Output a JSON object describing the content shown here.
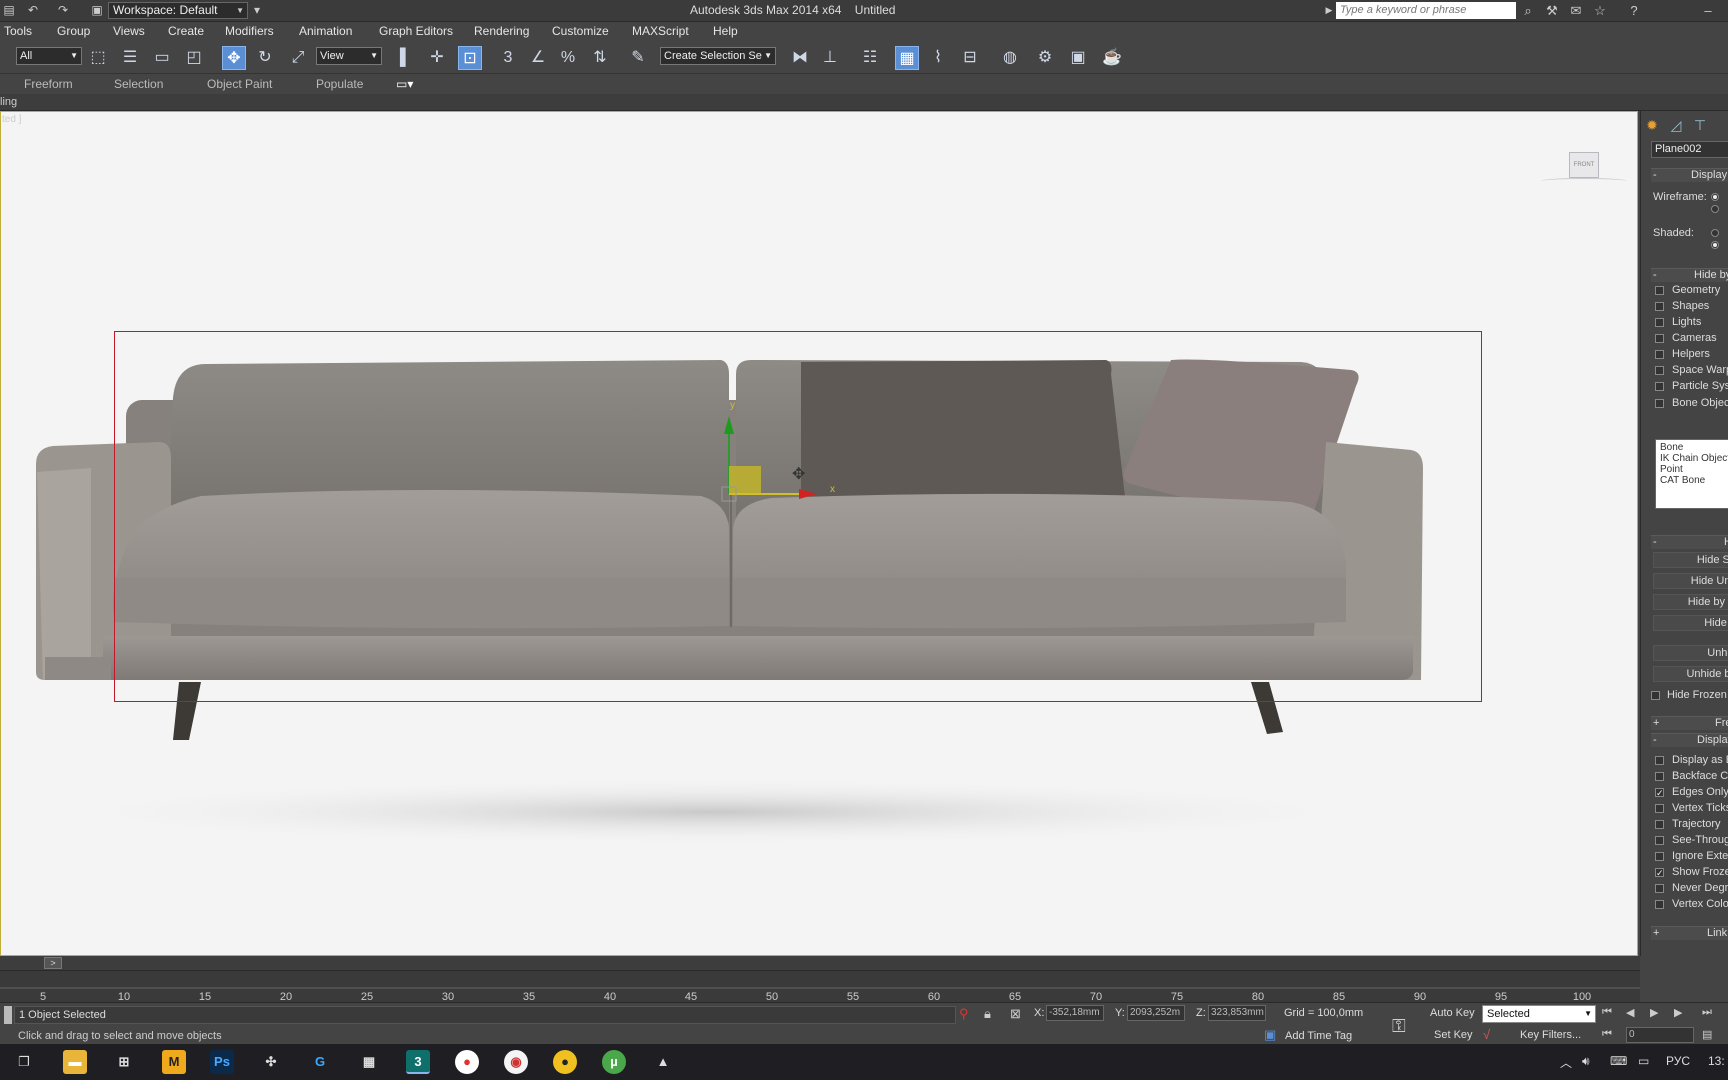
{
  "titlebar": {
    "workspace_label": "Workspace: Default",
    "app_title": "Autodesk 3ds Max  2014 x64",
    "doc_title": "Untitled",
    "search_placeholder": "Type a keyword or phrase"
  },
  "menu": {
    "items": [
      "Tools",
      "Group",
      "Views",
      "Create",
      "Modifiers",
      "Animation",
      "Graph Editors",
      "Rendering",
      "Customize",
      "MAXScript",
      "Help"
    ]
  },
  "toolbar": {
    "filter_value": "All",
    "refcoord_value": "View",
    "selection_set_value": "Create Selection Se",
    "snap_label": "3",
    "percent_label": "%"
  },
  "ribbon": {
    "tabs": [
      "Freeform",
      "Selection",
      "Object Paint",
      "Populate"
    ],
    "sub_label": "ling"
  },
  "viewport": {
    "label": "ted ]",
    "viewcube_label": "FRONT",
    "gizmo_y": "y",
    "gizmo_x": "x"
  },
  "command_panel": {
    "object_name": "Plane002",
    "rollout_display": "Display",
    "wireframe_label": "Wireframe:",
    "shaded_label": "Shaded:",
    "rollout_hide_by_category": "Hide by C",
    "categories": [
      {
        "label": "Geometry",
        "checked": false
      },
      {
        "label": "Shapes",
        "checked": false
      },
      {
        "label": "Lights",
        "checked": false
      },
      {
        "label": "Cameras",
        "checked": false
      },
      {
        "label": "Helpers",
        "checked": false
      },
      {
        "label": "Space Warp",
        "checked": false
      },
      {
        "label": "Particle Syst",
        "checked": false
      },
      {
        "label": "Bone Object",
        "checked": false
      }
    ],
    "bone_list": [
      "Bone",
      "IK Chain Object",
      "Point",
      "CAT Bone"
    ],
    "rollout_hide": "Hi",
    "hide_buttons": [
      "Hide Se",
      "Hide Uns",
      "Hide by N",
      "Hide b",
      "Unhid",
      "Unhide by"
    ],
    "hide_frozen_label": "Hide Frozen",
    "rollout_freeze": "Fre",
    "rollout_display_props": "Display P",
    "display_props": [
      {
        "label": "Display as B",
        "checked": false
      },
      {
        "label": "Backface Cu",
        "checked": false
      },
      {
        "label": "Edges Only",
        "checked": true
      },
      {
        "label": "Vertex Ticks",
        "checked": false
      },
      {
        "label": "Trajectory",
        "checked": false
      },
      {
        "label": "See-Throug",
        "checked": false
      },
      {
        "label": "Ignore Exte",
        "checked": false
      },
      {
        "label": "Show Froze",
        "checked": true
      },
      {
        "label": "Never Degr",
        "checked": false
      },
      {
        "label": "Vertex Colo",
        "checked": false
      }
    ],
    "rollout_link": "Link D"
  },
  "timeline": {
    "slider_arrow": ">",
    "ticks": [
      "5",
      "10",
      "15",
      "20",
      "25",
      "30",
      "35",
      "40",
      "45",
      "50",
      "55",
      "60",
      "65",
      "70",
      "75",
      "80",
      "85",
      "90",
      "95",
      "100"
    ]
  },
  "statusbar": {
    "selection_status": "1 Object Selected",
    "prompt": "Click and drag to select and move objects",
    "x_label": "X:",
    "x_value": "-352,18mm",
    "y_label": "Y:",
    "y_value": "2093,252m",
    "z_label": "Z:",
    "z_value": "323,853mm",
    "grid": "Grid = 100,0mm",
    "add_time_tag": "Add Time Tag",
    "auto_key": "Auto Key",
    "key_mode_value": "Selected",
    "set_key": "Set Key",
    "key_filters": "Key Filters...",
    "frame_value": "0"
  },
  "taskbar": {
    "lang": "РУС",
    "clock": "13:"
  },
  "colors": {
    "active_tool": "#5a8fd6",
    "safe_frame": "#c01a2a",
    "viewport_bg": "#f4f4f4"
  }
}
